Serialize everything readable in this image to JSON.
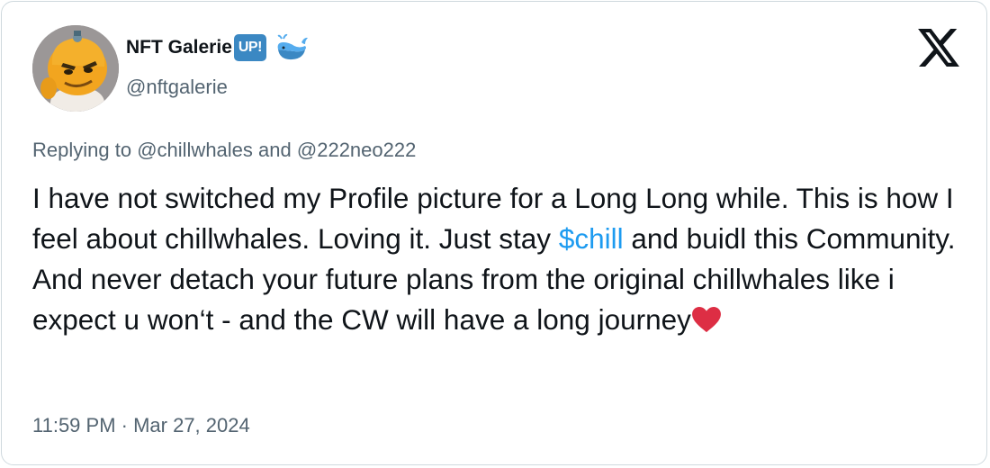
{
  "author": {
    "display_name": "NFT Galerie",
    "badge_text": "UP!",
    "emoji_icon": "whale-icon",
    "handle": "@nftgalerie",
    "avatar": "cartoon-character-avatar"
  },
  "platform": {
    "logo": "x-logo-icon"
  },
  "reply_context": {
    "prefix": "Replying to",
    "mentions": [
      "@chillwhales",
      "@222neo222"
    ],
    "separator": "and"
  },
  "tweet": {
    "text_part1": "I have not switched my Profile picture for a Long Long while. This is how I feel about chillwhales. Loving it. Just stay ",
    "cashtag": "$chill",
    "text_part2": " and buidl this Community. And never detach your future plans from the original chillwhales like i expect u won‘t - and the CW will have a long journey",
    "end_emoji": "heart-icon"
  },
  "timestamp": "11:59 PM · Mar 27, 2024",
  "colors": {
    "link": "#1d9bf0",
    "secondary_text": "#536471",
    "badge": "#3b88c3",
    "heart": "#dd2e44",
    "border": "#cfd9de"
  }
}
